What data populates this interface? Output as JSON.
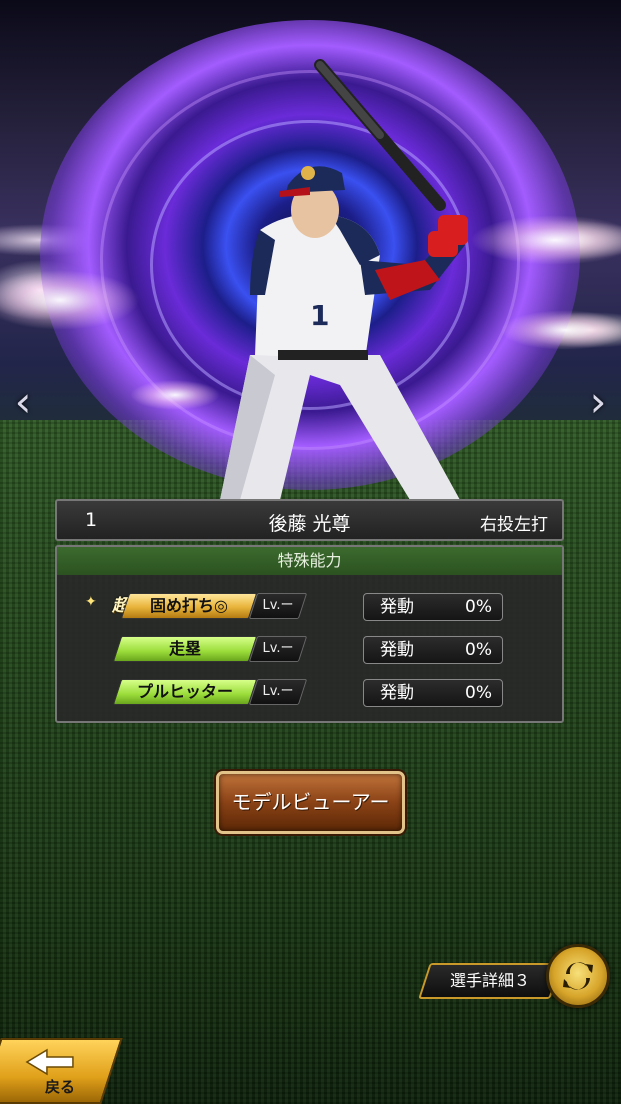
{
  "player": {
    "number": "1",
    "name": "後藤 光尊",
    "throw_bat": "右投左打",
    "jersey_number": "1"
  },
  "abilities": {
    "header": "特殊能力",
    "items": [
      {
        "badge": "超",
        "name": "固め打ち◎",
        "level": "Lv.ー",
        "activation_label": "発動",
        "activation_rate": "0%",
        "color": "gold"
      },
      {
        "badge": "",
        "name": "走塁",
        "level": "Lv.ー",
        "activation_label": "発動",
        "activation_rate": "0%",
        "color": "green"
      },
      {
        "badge": "",
        "name": "プルヒッター",
        "level": "Lv.ー",
        "activation_label": "発動",
        "activation_rate": "0%",
        "color": "green"
      }
    ]
  },
  "buttons": {
    "model_viewer": "モデルビューアー",
    "player_detail": "選手詳細３",
    "back": "戻る"
  },
  "nav": {
    "prev": "‹",
    "next": "›"
  },
  "colors": {
    "panel_header": "#3c6b2e",
    "gold_ability": "#e8b43a",
    "green_ability": "#9bdc3a",
    "button_brown": "#8a4216",
    "accent_gold": "#d7a52a"
  },
  "icons": {
    "cycle": "cycle-arrows-icon",
    "back": "back-arrow-icon"
  }
}
